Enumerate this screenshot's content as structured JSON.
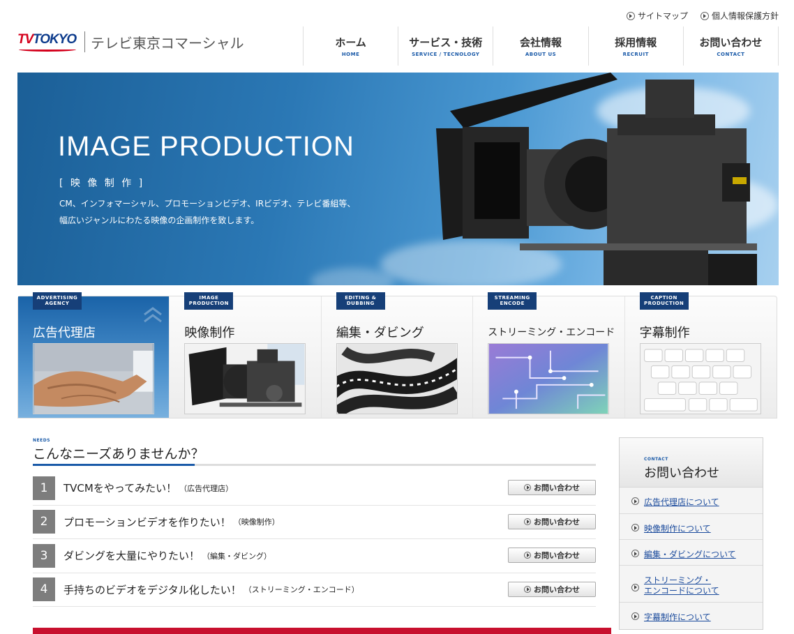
{
  "utility": {
    "sitemap": "サイトマップ",
    "privacy": "個人情報保護方針"
  },
  "logo": {
    "tv": "TV",
    "tokyo": "TOKYO",
    "company": "テレビ東京コマーシャル"
  },
  "nav": [
    {
      "ja": "ホーム",
      "en": "HOME"
    },
    {
      "ja": "サービス・技術",
      "en": "SERVICE / TECNOLOGY"
    },
    {
      "ja": "会社情報",
      "en": "ABOUT US"
    },
    {
      "ja": "採用情報",
      "en": "RECRUIT"
    },
    {
      "ja": "お問い合わせ",
      "en": "CONTACT"
    }
  ],
  "hero": {
    "title": "IMAGE PRODUCTION",
    "subtitle": "[ 映 像 制 作 ]",
    "desc1": "CM、インフォマーシャル、プロモーションビデオ、IRビデオ、テレビ番組等、",
    "desc2": "幅広いジャンルにわたる映像の企画制作を致します。"
  },
  "services": [
    {
      "tag1": "ADVERTISING",
      "tag2": "AGENCY",
      "title": "広告代理店"
    },
    {
      "tag1": "IMAGE",
      "tag2": "PRODUCTION",
      "title": "映像制作"
    },
    {
      "tag1": "EDITING &",
      "tag2": "DUBBING",
      "title": "編集・ダビング"
    },
    {
      "tag1": "STREAMING",
      "tag2": "ENCODE",
      "title": "ストリーミング・エンコード"
    },
    {
      "tag1": "CAPTION",
      "tag2": "PRODUCTION",
      "title": "字幕制作"
    }
  ],
  "needs": {
    "en": "NEEDS",
    "title": "こんなニーズありませんか？",
    "button": "お問い合わせ",
    "items": [
      {
        "num": "1",
        "text": "TVCMをやってみたい！",
        "note": "（広告代理店）"
      },
      {
        "num": "2",
        "text": "プロモーションビデオを作りたい！",
        "note": "（映像制作）"
      },
      {
        "num": "3",
        "text": "ダビングを大量にやりたい！",
        "note": "（編集・ダビング）"
      },
      {
        "num": "4",
        "text": "手持ちのビデオをデジタル化したい！",
        "note": "（ストリーミング・エンコード）"
      }
    ]
  },
  "contact": {
    "en": "CONTACT",
    "title": "お問い合わせ",
    "links": [
      {
        "line1": "広告代理店について",
        "line2": ""
      },
      {
        "line1": "映像制作について",
        "line2": ""
      },
      {
        "line1": "編集・ダビングについて",
        "line2": ""
      },
      {
        "line1": "ストリーミング・",
        "line2": "エンコードについて"
      },
      {
        "line1": "字幕制作について",
        "line2": ""
      }
    ]
  },
  "colors": {
    "brand_red": "#d4001c",
    "brand_blue": "#0d3b8c",
    "accent_blue": "#1a5aa8",
    "tag_navy": "#163f78"
  }
}
